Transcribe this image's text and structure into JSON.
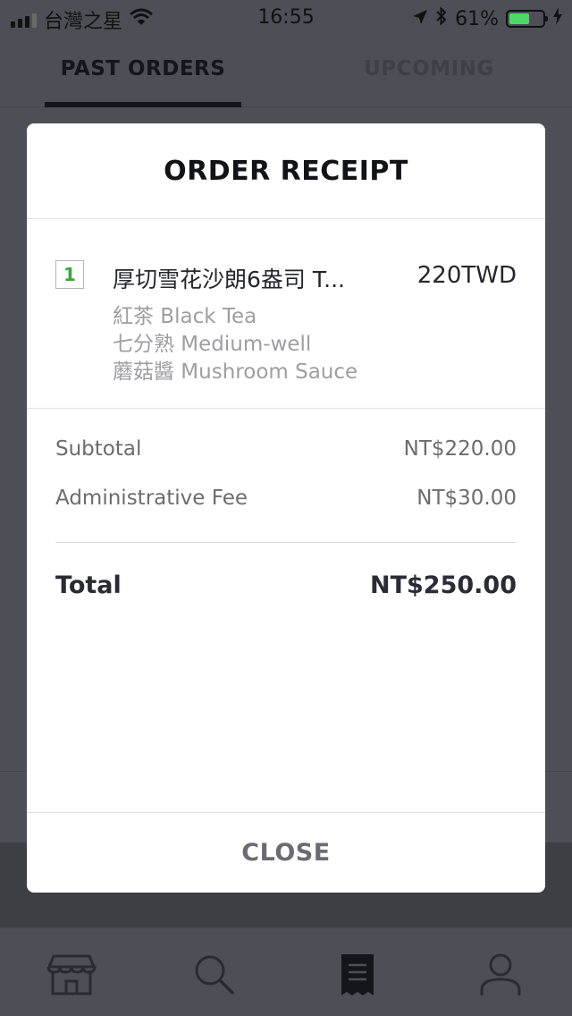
{
  "status_bar": {
    "carrier": "台灣之星",
    "time": "16:55",
    "battery": "61%",
    "battery_level": 0.61,
    "icons": [
      "signal-icon",
      "wifi-icon",
      "location-arrow-icon",
      "bluetooth-icon",
      "battery-icon",
      "charging-bolt-icon"
    ]
  },
  "tabs": [
    {
      "label": "PAST ORDERS",
      "active": true
    },
    {
      "label": "UPCOMING",
      "active": false
    }
  ],
  "modal": {
    "title": "ORDER RECEIPT",
    "item": {
      "quantity": "1",
      "name": "厚切雪花沙朗6盎司 T...",
      "price": "220TWD",
      "modifiers": [
        "紅茶 Black Tea",
        "七分熟 Medium-well",
        "蘑菇醬 Mushroom Sauce"
      ]
    },
    "summary": {
      "subtotal_label": "Subtotal",
      "subtotal_value": "NT$220.00",
      "fee_label": "Administrative Fee",
      "fee_value": "NT$30.00",
      "total_label": "Total",
      "total_value": "NT$250.00"
    },
    "close_label": "CLOSE"
  },
  "bottom_nav": [
    {
      "icon": "store-icon",
      "active": false
    },
    {
      "icon": "search-icon",
      "active": false
    },
    {
      "icon": "receipt-icon",
      "active": true
    },
    {
      "icon": "profile-icon",
      "active": false
    }
  ],
  "colors": {
    "overlay_background": "#4e4f56",
    "modal_background": "#ffffff",
    "quantity_green": "#3aa63a",
    "battery_green": "#4cd964"
  }
}
